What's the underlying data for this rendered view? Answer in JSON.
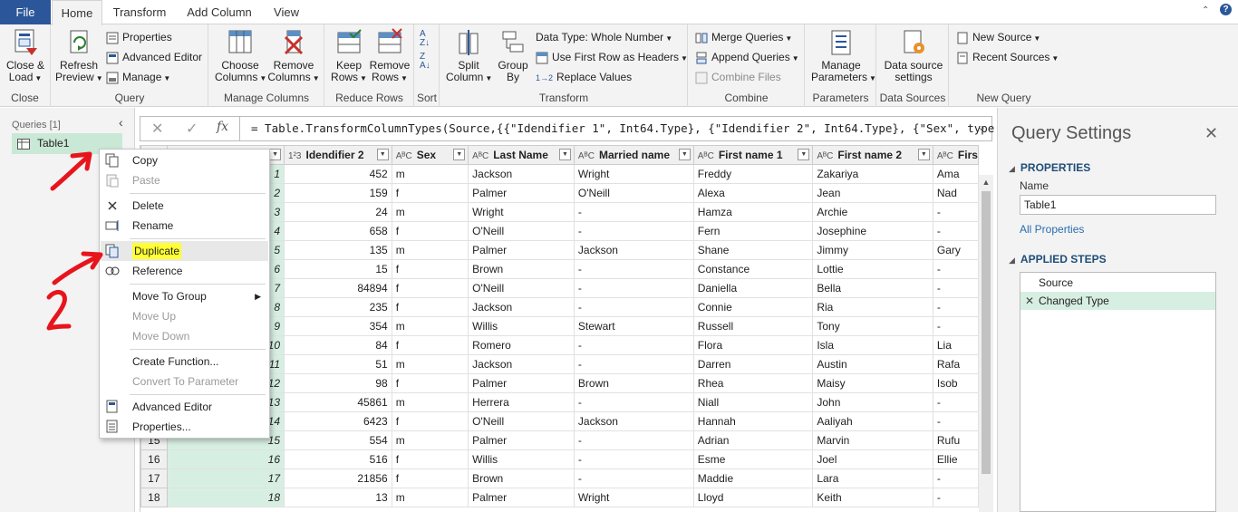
{
  "tabs": {
    "file": "File",
    "home": "Home",
    "transform": "Transform",
    "add_column": "Add Column",
    "view": "View"
  },
  "ribbon": {
    "close_group": {
      "label": "Close",
      "close_load": "Close &",
      "close_load2": "Load"
    },
    "query_group": {
      "label": "Query",
      "refresh": "Refresh",
      "refresh2": "Preview",
      "properties": "Properties",
      "advanced_editor": "Advanced Editor",
      "manage": "Manage"
    },
    "manage_columns_group": {
      "label": "Manage Columns",
      "choose": "Choose",
      "choose2": "Columns",
      "remove": "Remove",
      "remove2": "Columns"
    },
    "reduce_rows_group": {
      "label": "Reduce Rows",
      "keep": "Keep",
      "keep2": "Rows",
      "remove": "Remove",
      "remove2": "Rows"
    },
    "sort_group": {
      "label": "Sort"
    },
    "transform_group": {
      "label": "Transform",
      "split": "Split",
      "split2": "Column",
      "group": "Group",
      "group2": "By",
      "data_type": "Data Type: Whole Number",
      "first_row": "Use First Row as Headers",
      "replace": "Replace Values"
    },
    "combine_group": {
      "label": "Combine",
      "merge": "Merge Queries",
      "append": "Append Queries",
      "combine_files": "Combine Files"
    },
    "parameters_group": {
      "label": "Parameters",
      "manage": "Manage",
      "manage2": "Parameters"
    },
    "data_sources_group": {
      "label": "Data Sources",
      "settings": "Data source",
      "settings2": "settings"
    },
    "new_query_group": {
      "label": "New Query",
      "new_source": "New Source",
      "recent": "Recent Sources"
    }
  },
  "queries_pane": {
    "header": "Queries [1]",
    "item": "Table1"
  },
  "formula_bar": {
    "fx": "fx",
    "formula": "= Table.TransformColumnTypes(Source,{{\"Idendifier 1\", Int64.Type}, {\"Idendifier 2\", Int64.Type}, {\"Sex\", type text},"
  },
  "grid": {
    "columns": [
      {
        "type": "",
        "name": ""
      },
      {
        "type": "1²3",
        "name": "Idendifier 2"
      },
      {
        "type": "AᴮC",
        "name": "Sex"
      },
      {
        "type": "AᴮC",
        "name": "Last Name"
      },
      {
        "type": "AᴮC",
        "name": "Married name"
      },
      {
        "type": "AᴮC",
        "name": "First name 1"
      },
      {
        "type": "AᴮC",
        "name": "First name 2"
      },
      {
        "type": "AᴮC",
        "name": "Firs"
      }
    ],
    "rows": [
      [
        "1",
        "1",
        "452",
        "m",
        "Jackson",
        "Wright",
        "Freddy",
        "Zakariya",
        "Ama"
      ],
      [
        "2",
        "2",
        "159",
        "f",
        "Palmer",
        "O'Neill",
        "Alexa",
        "Jean",
        "Nad"
      ],
      [
        "3",
        "3",
        "24",
        "m",
        "Wright",
        "-",
        "Hamza",
        "Archie",
        "-"
      ],
      [
        "4",
        "4",
        "658",
        "f",
        "O'Neill",
        "-",
        "Fern",
        "Josephine",
        "-"
      ],
      [
        "5",
        "5",
        "135",
        "m",
        "Palmer",
        "Jackson",
        "Shane",
        "Jimmy",
        "Gary"
      ],
      [
        "6",
        "6",
        "15",
        "f",
        "Brown",
        "-",
        "Constance",
        "Lottie",
        "-"
      ],
      [
        "7",
        "7",
        "84894",
        "f",
        "O'Neill",
        "-",
        "Daniella",
        "Bella",
        "-"
      ],
      [
        "8",
        "8",
        "235",
        "f",
        "Jackson",
        "-",
        "Connie",
        "Ria",
        "-"
      ],
      [
        "9",
        "9",
        "354",
        "m",
        "Willis",
        "Stewart",
        "Russell",
        "Tony",
        "-"
      ],
      [
        "10",
        "10",
        "84",
        "f",
        "Romero",
        "-",
        "Flora",
        "Isla",
        "Lia"
      ],
      [
        "11",
        "11",
        "51",
        "m",
        "Jackson",
        "-",
        "Darren",
        "Austin",
        "Rafa"
      ],
      [
        "12",
        "12",
        "98",
        "f",
        "Palmer",
        "Brown",
        "Rhea",
        "Maisy",
        "Isob"
      ],
      [
        "13",
        "13",
        "45861",
        "m",
        "Herrera",
        "-",
        "Niall",
        "John",
        "-"
      ],
      [
        "14",
        "14",
        "6423",
        "f",
        "O'Neill",
        "Jackson",
        "Hannah",
        "Aaliyah",
        "-"
      ],
      [
        "15",
        "15",
        "554",
        "m",
        "Palmer",
        "-",
        "Adrian",
        "Marvin",
        "Rufu"
      ],
      [
        "16",
        "16",
        "516",
        "f",
        "Willis",
        "-",
        "Esme",
        "Joel",
        "Ellie"
      ],
      [
        "17",
        "17",
        "21856",
        "f",
        "Brown",
        "-",
        "Maddie",
        "Lara",
        "-"
      ],
      [
        "18",
        "18",
        "13",
        "m",
        "Palmer",
        "Wright",
        "Lloyd",
        "Keith",
        "-"
      ]
    ]
  },
  "query_settings": {
    "title": "Query Settings",
    "properties_header": "PROPERTIES",
    "name_label": "Name",
    "name_value": "Table1",
    "all_properties": "All Properties",
    "applied_steps_header": "APPLIED STEPS",
    "steps": [
      "Source",
      "Changed Type"
    ]
  },
  "context_menu": {
    "copy": "Copy",
    "paste": "Paste",
    "delete": "Delete",
    "rename": "Rename",
    "duplicate": "Duplicate",
    "reference": "Reference",
    "move_to_group": "Move To Group",
    "move_up": "Move Up",
    "move_down": "Move Down",
    "create_function": "Create Function...",
    "convert_param": "Convert To Parameter",
    "advanced_editor": "Advanced Editor",
    "properties": "Properties..."
  },
  "colors": {
    "file_tab": "#2b579a",
    "selection_green": "#c9e8d6",
    "annotation_red": "#e8141c",
    "highlight_yellow": "#ffff33"
  }
}
